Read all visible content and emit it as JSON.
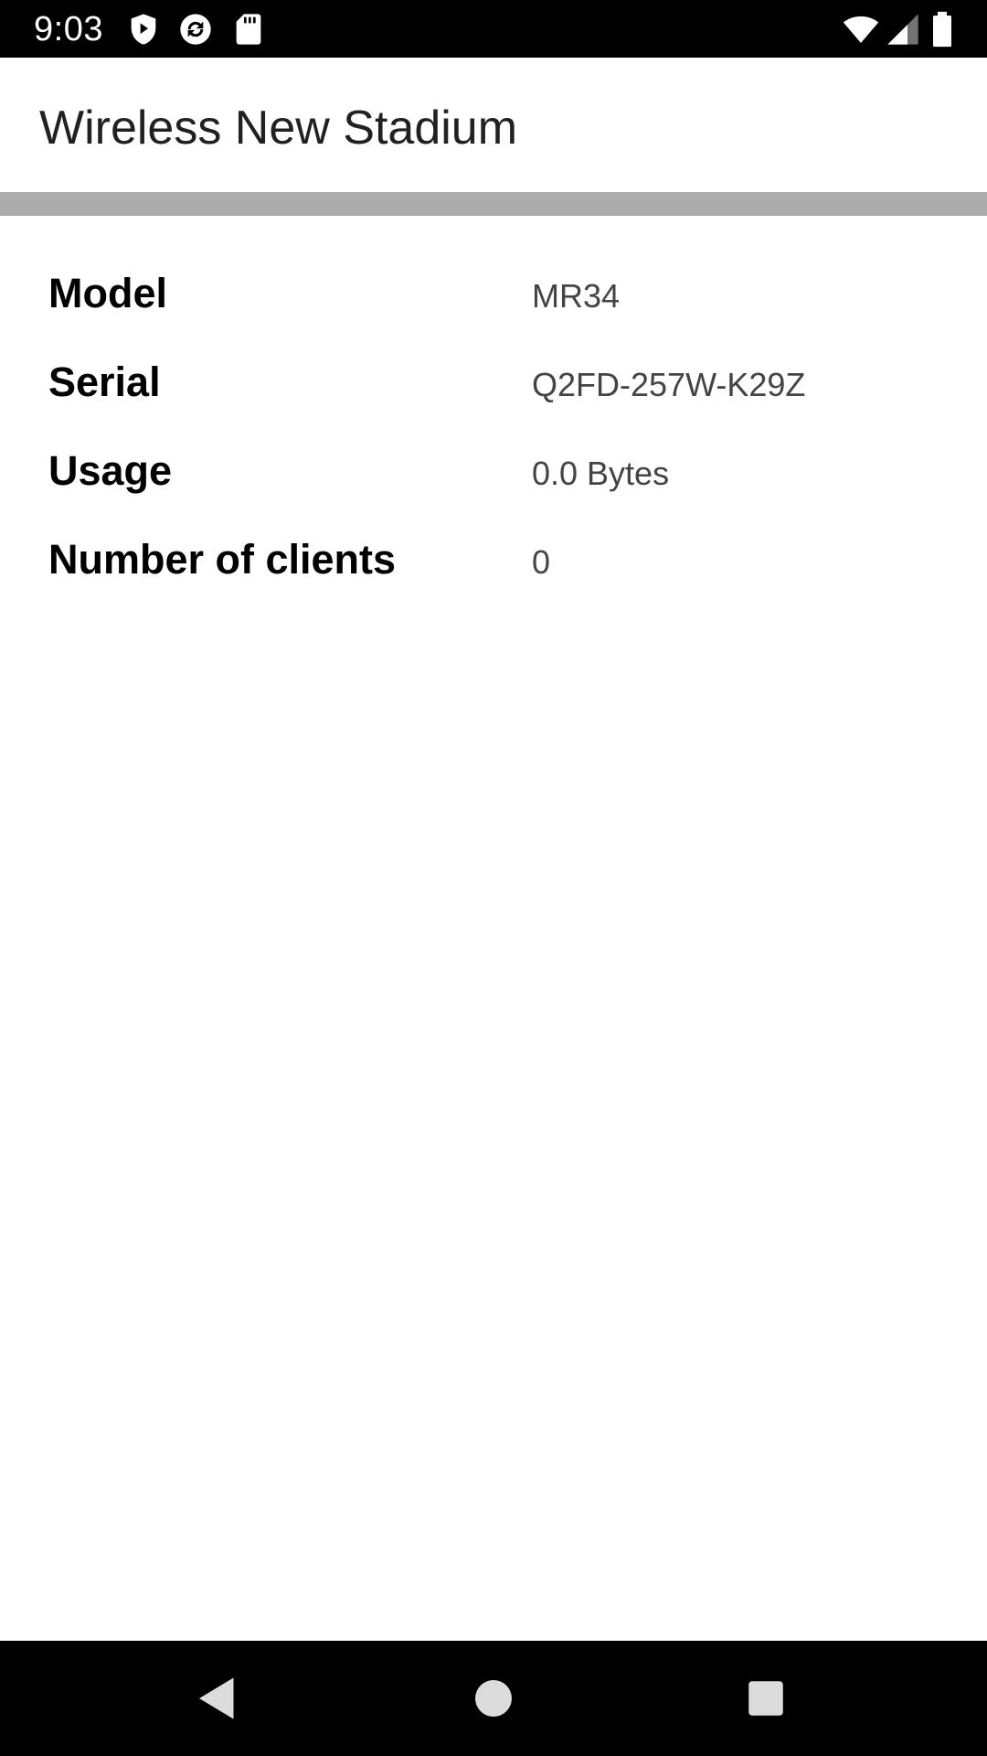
{
  "status_bar": {
    "time": "9:03",
    "icons": [
      "shield-icon",
      "sync-icon",
      "sd-card-icon",
      "wifi-icon",
      "signal-icon",
      "battery-icon"
    ]
  },
  "app_bar": {
    "title": "Wireless New Stadium"
  },
  "details": [
    {
      "label": "Model",
      "value": "MR34"
    },
    {
      "label": "Serial",
      "value": "Q2FD-257W-K29Z"
    },
    {
      "label": "Usage",
      "value": "0.0 Bytes"
    },
    {
      "label": "Number of clients",
      "value": "0"
    }
  ],
  "nav_bar": {
    "buttons": [
      "back-icon",
      "home-icon",
      "recents-icon"
    ]
  },
  "colors": {
    "status_bar_bg": "#000000",
    "app_bar_bg": "#ffffff",
    "divider_band": "#acacac",
    "label_text": "#000000",
    "value_text": "#444444"
  }
}
